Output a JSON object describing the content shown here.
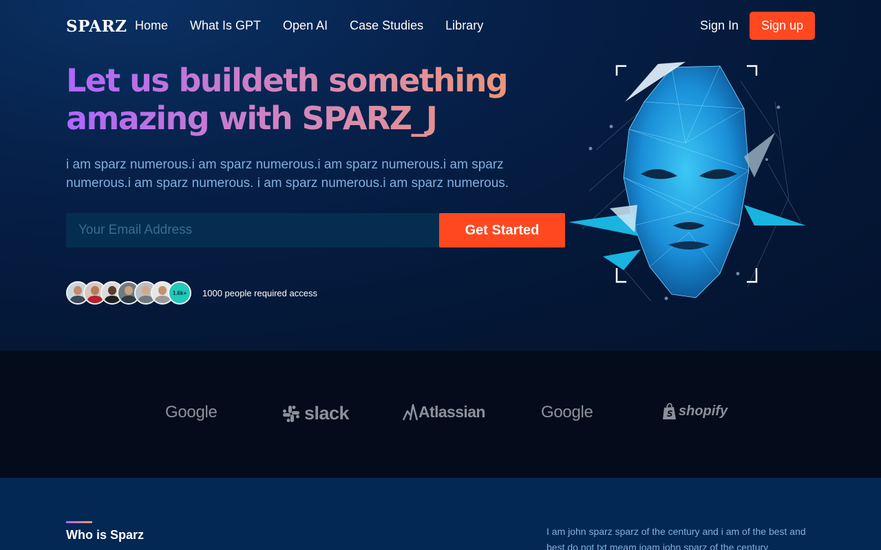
{
  "nav": {
    "logo": "SPARZ",
    "links": [
      "Home",
      "What Is GPT",
      "Open AI",
      "Case Studies",
      "Library"
    ],
    "sign_in": "Sign In",
    "sign_up": "Sign up"
  },
  "hero": {
    "headline_line1": "Let us buildeth something",
    "headline_line2": "amazing with SPARZ_J",
    "subtext": "i am sparz numerous.i am sparz numerous.i am sparz numerous.i am sparz numerous.i am sparz numerous. i am sparz numerous.i am sparz numerous.",
    "email_placeholder": "Your Email Address",
    "cta": "Get Started",
    "avatar_badge": "1.6k+",
    "access_text": "1000 people required access"
  },
  "brands": [
    "Google",
    "slack",
    "Atlassian",
    "Google",
    "shopify"
  ],
  "about": {
    "title": "Who is Sparz",
    "text": "I am john sparz sparz of the century and i am of the best and best do not txt meam joam john sparz of the century"
  },
  "colors": {
    "accent": "#ff4820",
    "gradient_start": "#ae67fa",
    "gradient_end": "#f49867",
    "hero_bg": "#062049",
    "logos_bg": "#040c1b",
    "about_bg": "#042854",
    "subtext": "#81afdd"
  }
}
